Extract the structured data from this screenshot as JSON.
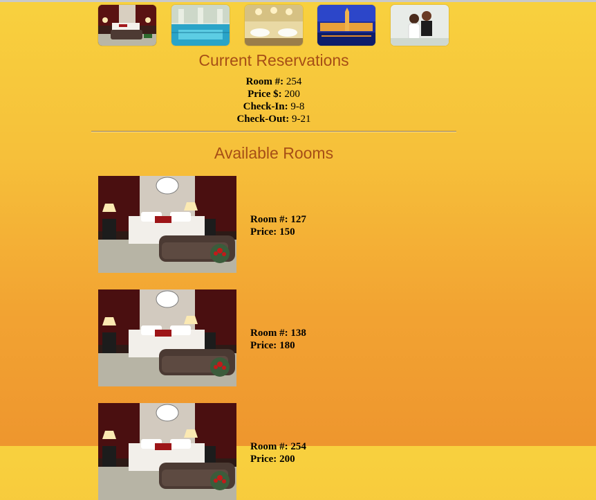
{
  "thumbnails": [
    {
      "icon": "bedroom-thumbnail-icon"
    },
    {
      "icon": "indoor-pool-thumbnail-icon"
    },
    {
      "icon": "dining-hall-thumbnail-icon"
    },
    {
      "icon": "night-city-thumbnail-icon"
    },
    {
      "icon": "couple-wedding-thumbnail-icon"
    }
  ],
  "current": {
    "title": "Current Reservations",
    "fields": [
      {
        "label": "Room #:",
        "value": "254"
      },
      {
        "label": "Price $:",
        "value": "200"
      },
      {
        "label": "Check-In:",
        "value": "9-8"
      },
      {
        "label": "Check-Out:",
        "value": "9-21"
      }
    ]
  },
  "available": {
    "title": "Available Rooms",
    "rooms": [
      {
        "room_label": "Room #:",
        "room_value": "127",
        "price_label": "Price:",
        "price_value": "150"
      },
      {
        "room_label": "Room #:",
        "room_value": "138",
        "price_label": "Price:",
        "price_value": "180"
      },
      {
        "room_label": "Room #:",
        "room_value": "254",
        "price_label": "Price:",
        "price_value": "200"
      }
    ]
  },
  "colors": {
    "title": "#a64e16",
    "bg_top": "#f8d13e",
    "bg_bottom": "#ee962e"
  }
}
